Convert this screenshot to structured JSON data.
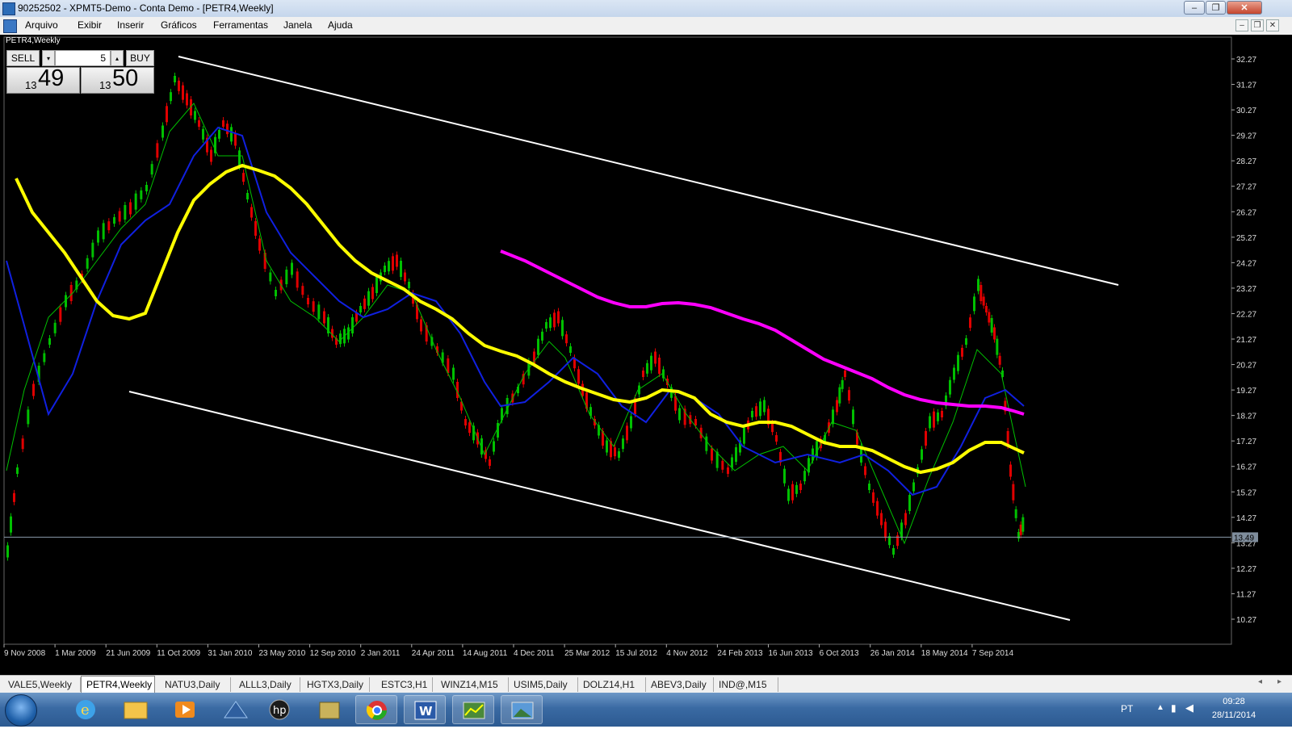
{
  "window": {
    "title": "90252502 - XPMT5-Demo - Conta Demo - [PETR4,Weekly]"
  },
  "menu": {
    "items": [
      "Arquivo",
      "Exibir",
      "Inserir",
      "Gráficos",
      "Ferramentas",
      "Janela",
      "Ajuda"
    ]
  },
  "chart": {
    "symbol_label": "PETR4,Weekly",
    "price_axis": [
      "32.27",
      "31.27",
      "30.27",
      "29.27",
      "28.27",
      "27.27",
      "26.27",
      "25.27",
      "24.27",
      "23.27",
      "22.27",
      "21.27",
      "20.27",
      "19.27",
      "18.27",
      "17.27",
      "16.27",
      "15.27",
      "14.27",
      "13.27",
      "12.27",
      "11.27",
      "10.27"
    ],
    "date_axis": [
      "9 Nov 2008",
      "1 Mar 2009",
      "21 Jun 2009",
      "11 Oct 2009",
      "31 Jan 2010",
      "23 May 2010",
      "12 Sep 2010",
      "2 Jan 2011",
      "24 Apr 2011",
      "14 Aug 2011",
      "4 Dec 2011",
      "25 Mar 2012",
      "15 Jul 2012",
      "4 Nov 2012",
      "24 Feb 2013",
      "16 Jun 2013",
      "6 Oct 2013",
      "26 Jan 2014",
      "18 May 2014",
      "7 Sep 2014"
    ],
    "current_price": "13.49",
    "colors": {
      "background": "#000000",
      "bull": "#00c000",
      "bear": "#e00000",
      "ma_fast": "#00c000",
      "ma_mid": "#1020e0",
      "ma_slow": "#ffff00",
      "ma_long": "#ff00ff",
      "channel": "#ffffff"
    }
  },
  "one_click": {
    "sell_label": "SELL",
    "buy_label": "BUY",
    "volume": "5",
    "bid_prefix": "13",
    "bid_main": "49",
    "ask_prefix": "13",
    "ask_main": "50"
  },
  "tabs": [
    {
      "label": "VALE5,Weekly",
      "active": false
    },
    {
      "label": "PETR4,Weekly",
      "active": true
    },
    {
      "label": "NATU3,Daily",
      "active": false
    },
    {
      "label": "ALLL3,Daily",
      "active": false
    },
    {
      "label": "HGTX3,Daily",
      "active": false
    },
    {
      "label": "ESTC3,H1",
      "active": false
    },
    {
      "label": "WINZ14,M15",
      "active": false
    },
    {
      "label": "USIM5,Daily",
      "active": false
    },
    {
      "label": "DOLZ14,H1",
      "active": false
    },
    {
      "label": "ABEV3,Daily",
      "active": false
    },
    {
      "label": "IND@,M15",
      "active": false
    }
  ],
  "taskbar": {
    "icons": [
      "windows-start-icon",
      "internet-explorer-icon",
      "file-explorer-icon",
      "media-player-icon",
      "network-app-icon",
      "hp-icon",
      "archive-icon",
      "chrome-icon",
      "word-icon",
      "metatrader-icon",
      "photo-viewer-icon"
    ],
    "language": "PT",
    "time": "09:28",
    "date": "28/11/2014"
  }
}
